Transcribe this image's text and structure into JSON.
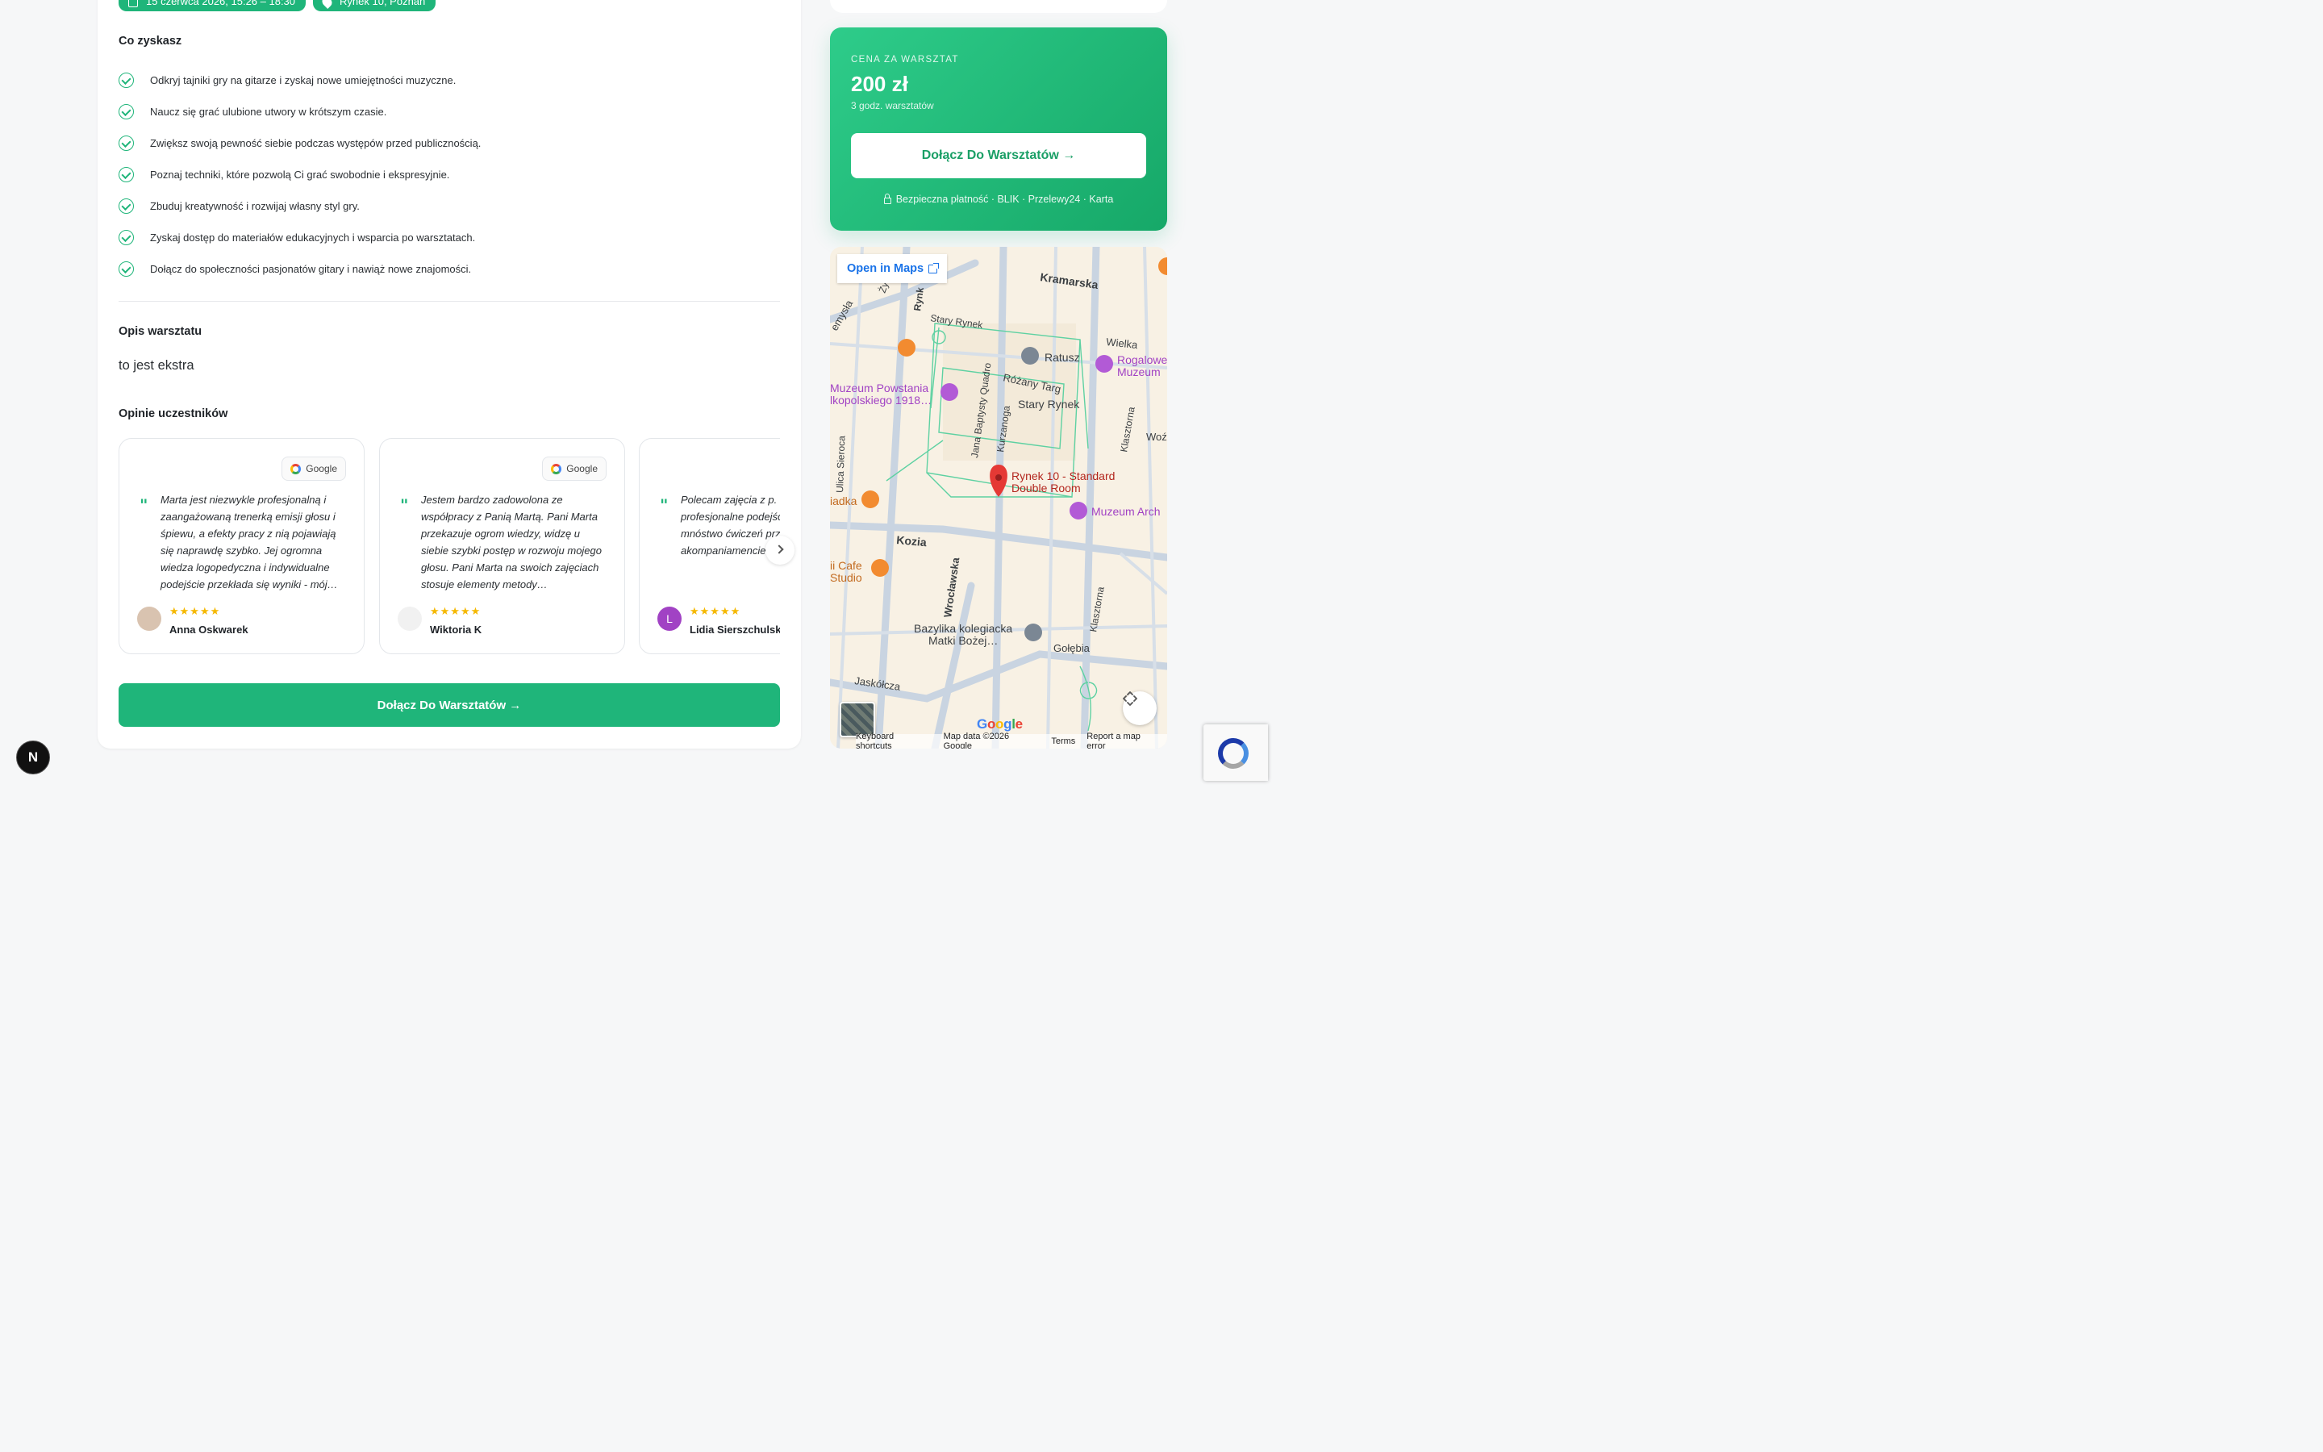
{
  "event": {
    "date_pill": "15 czerwca 2026, 15:26 – 18:30",
    "location_pill": "Rynek 10, Poznań"
  },
  "benefits": {
    "title": "Co zyskasz",
    "items": [
      "Odkryj tajniki gry na gitarze i zyskaj nowe umiejętności muzyczne.",
      "Naucz się grać ulubione utwory w krótszym czasie.",
      "Zwiększ swoją pewność siebie podczas występów przed publicznością.",
      "Poznaj techniki, które pozwolą Ci grać swobodnie i ekspresyjnie.",
      "Zbuduj kreatywność i rozwijaj własny styl gry.",
      "Zyskaj dostęp do materiałów edukacyjnych i wsparcia po warsztatach.",
      "Dołącz do społeczności pasjonatów gitary i nawiąż nowe znajomości."
    ]
  },
  "description": {
    "title": "Opis warsztatu",
    "text": "to jest ekstra"
  },
  "reviews": {
    "title": "Opinie uczestników",
    "source_label": "Google",
    "stars": "★★★★★",
    "items": [
      {
        "text": "Marta jest niezwykle profesjonalną i zaangażowaną trenerką emisji głosu i śpiewu, a efekty pracy z nią pojawiają się naprawdę szybko. Jej ogromna wiedza logopedyczna i indywidualne podejście przekłada się wyniki - mój…",
        "author": "Anna Oskwarek",
        "avatar_letter": "",
        "avatar_color": "#d9c3b0"
      },
      {
        "text": "Jestem bardzo zadowolona ze współpracy z Panią Martą. Pani Marta przekazuje ogrom wiedzy, widzę u siebie szybki postęp w rozwoju mojego głosu. Pani Marta na swoich zajęciach stosuje elementy metody…",
        "author": "Wiktoria K",
        "avatar_letter": "",
        "avatar_color": "#f1f1f1"
      },
      {
        "text": "Polecam zajęcia z p. Martą! Bardzo profesjonalne podejście, dobry humor i mnóstwo ćwiczeń przy akompaniamencie ulubionych utworów.",
        "author": "Lidia Sierszchulska",
        "avatar_letter": "L",
        "avatar_color": "#a142c4"
      }
    ]
  },
  "cta": {
    "join_label": "Dołącz Do Warsztatów →"
  },
  "pricing": {
    "label": "CENA ZA WARSZTAT",
    "value": "200 zł",
    "duration": "3 godz. warsztatów",
    "button_label": "Dołącz Do Warsztatów →",
    "secure_text": "Bezpieczna płatność · BLIK · Przelewy24 · Karta"
  },
  "map": {
    "open_label": "Open in Maps",
    "marker_label_1": "Rynek 10 - Standard",
    "marker_label_2": "Double Room",
    "labels": {
      "kramarska": "Kramarska",
      "stary_rynek_st": "Stary Rynek",
      "wielka": "Wielka",
      "ratusz": "Ratusz",
      "rogalowe_1": "Rogalowe",
      "rogalowe_2": "Muzeum",
      "muzeum_powstania_1": "Muzeum Powstania",
      "muzeum_powstania_2": "lkopolskiego 1918…",
      "rozany_targ": "Różany Targ",
      "stary_rynek": "Stary Rynek",
      "jana_baptysty": "Jana Baptysty Quadro",
      "kurzanoga": "Kurzanoga",
      "klasztorna": "Klasztorna",
      "woz": "Woź",
      "ulica_sieroca": "Ulica Sieroca",
      "iadka": "iadka",
      "muzeum_arch": "Muzeum Arch",
      "kozia": "Kozia",
      "cafe_1": "ii Cafe",
      "cafe_2": "Studio",
      "wroclawska": "Wrocławska",
      "klasztorna_2": "Klasztorna",
      "bazylika_1": "Bazylika kolegiacka",
      "bazylika_2": "Matki Bożej…",
      "golebia": "Gołębia",
      "jaskolcza": "Jaskółcza",
      "rynk": "Rynk",
      "zydowska": "Ży",
      "emysla": "emysła"
    },
    "google_logo": "Google",
    "footer": [
      "Keyboard shortcuts",
      "Map data ©2026 Google",
      "Terms",
      "Report a map error"
    ]
  },
  "badge": {
    "letter": "N"
  },
  "colors": {
    "accent": "#1fb57a",
    "map_bg": "#f8f1e4",
    "road": "#c8d3e0",
    "marker": "#e53935"
  }
}
